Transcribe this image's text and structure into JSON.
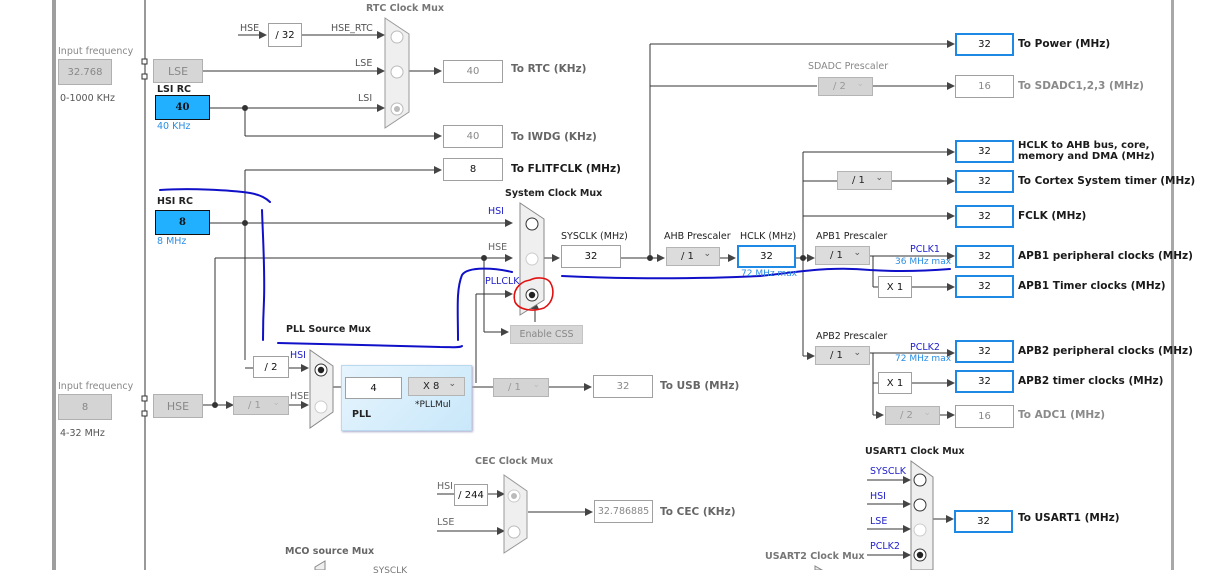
{
  "left_panel": {
    "lse_input": {
      "label": "Input frequency",
      "value": "32.768",
      "range": "0-1000 KHz"
    },
    "hse_input": {
      "label": "Input frequency",
      "value": "8",
      "range": "4-32 MHz"
    }
  },
  "sources": {
    "lse": "LSE",
    "lsi_rc": {
      "title": "LSI RC",
      "value": "40",
      "unit": "40 KHz"
    },
    "hsi_rc": {
      "title": "HSI RC",
      "value": "8",
      "unit": "8 MHz"
    },
    "hse": "HSE"
  },
  "rtc": {
    "mux_title": "RTC Clock Mux",
    "hse_label": "HSE",
    "hse_div": "/ 32",
    "hse_rtc_label": "HSE_RTC",
    "lse_label": "LSE",
    "lsi_label": "LSI",
    "selected": "LSI",
    "out_value": "40",
    "out_label": "To RTC (KHz)"
  },
  "iwdg": {
    "value": "40",
    "label": "To IWDG (KHz)"
  },
  "flitf": {
    "value": "8",
    "label": "To FLITFCLK (MHz)"
  },
  "system_mux": {
    "title": "System Clock Mux",
    "inputs": [
      "HSI",
      "HSE",
      "PLLCLK"
    ],
    "selected": "PLLCLK",
    "enable_css": "Enable CSS"
  },
  "pll_source": {
    "title": "PLL Source Mux",
    "hsi_div": "/ 2",
    "hsi_label": "HSI",
    "hse_label": "HSE",
    "hse_prediv": "/ 1",
    "selected": "HSI"
  },
  "pll": {
    "label": "PLL",
    "input_value": "4",
    "mul_value": "X 8",
    "mul_label": "*PLLMul"
  },
  "usb": {
    "prescaler": "/ 1",
    "value": "32",
    "label": "To USB (MHz)"
  },
  "sysclk": {
    "label": "SYSCLK (MHz)",
    "value": "32"
  },
  "ahb": {
    "label": "AHB Prescaler",
    "value": "/ 1"
  },
  "hclk": {
    "label": "HCLK (MHz)",
    "value": "32",
    "max": "72 MHz max"
  },
  "power": {
    "value": "32",
    "label": "To Power (MHz)"
  },
  "sdadc": {
    "prescaler_label": "SDADC Prescaler",
    "prescaler": "/ 2",
    "value": "16",
    "label": "To SDADC1,2,3 (MHz)"
  },
  "hclk_ahb": {
    "value": "32",
    "label_line1": "HCLK to AHB bus, core,",
    "label_line2": "memory and DMA (MHz)"
  },
  "cortex_timer": {
    "prescaler": "/ 1",
    "value": "32",
    "label": "To Cortex System timer (MHz)"
  },
  "fclk": {
    "value": "32",
    "label": "FCLK (MHz)"
  },
  "apb1": {
    "prescaler_label": "APB1 Prescaler",
    "prescaler": "/ 1",
    "pclk_label": "PCLK1",
    "pclk_max": "36 MHz max",
    "periph_value": "32",
    "periph_label": "APB1 peripheral clocks (MHz)",
    "timer_mult": "X 1",
    "timer_value": "32",
    "timer_label": "APB1 Timer clocks (MHz)"
  },
  "apb2": {
    "prescaler_label": "APB2 Prescaler",
    "prescaler": "/ 1",
    "pclk_label": "PCLK2",
    "pclk_max": "72 MHz max",
    "periph_value": "32",
    "periph_label": "APB2 peripheral clocks (MHz)",
    "timer_mult": "X 1",
    "timer_value": "32",
    "timer_label": "APB2 timer clocks (MHz)",
    "adc_prescaler": "/ 2",
    "adc_value": "16",
    "adc_label": "To ADC1 (MHz)"
  },
  "cec": {
    "mux_title": "CEC Clock Mux",
    "hsi_label": "HSI",
    "hsi_div": "/ 244",
    "lse_label": "LSE",
    "selected": "HSI",
    "value": "32.786885",
    "label": "To CEC (KHz)"
  },
  "usart1": {
    "mux_title": "USART1 Clock Mux",
    "inputs": [
      "SYSCLK",
      "HSI",
      "LSE",
      "PCLK2"
    ],
    "selected": "PCLK2",
    "value": "32",
    "label": "To USART1 (MHz)"
  },
  "usart2": {
    "mux_title": "USART2 Clock Mux"
  },
  "mco": {
    "mux_title": "MCO source Mux",
    "first_input": "SYSCLK"
  },
  "annotations": {
    "pen_color": "#1010c8",
    "highlight_color": "#e01010"
  }
}
